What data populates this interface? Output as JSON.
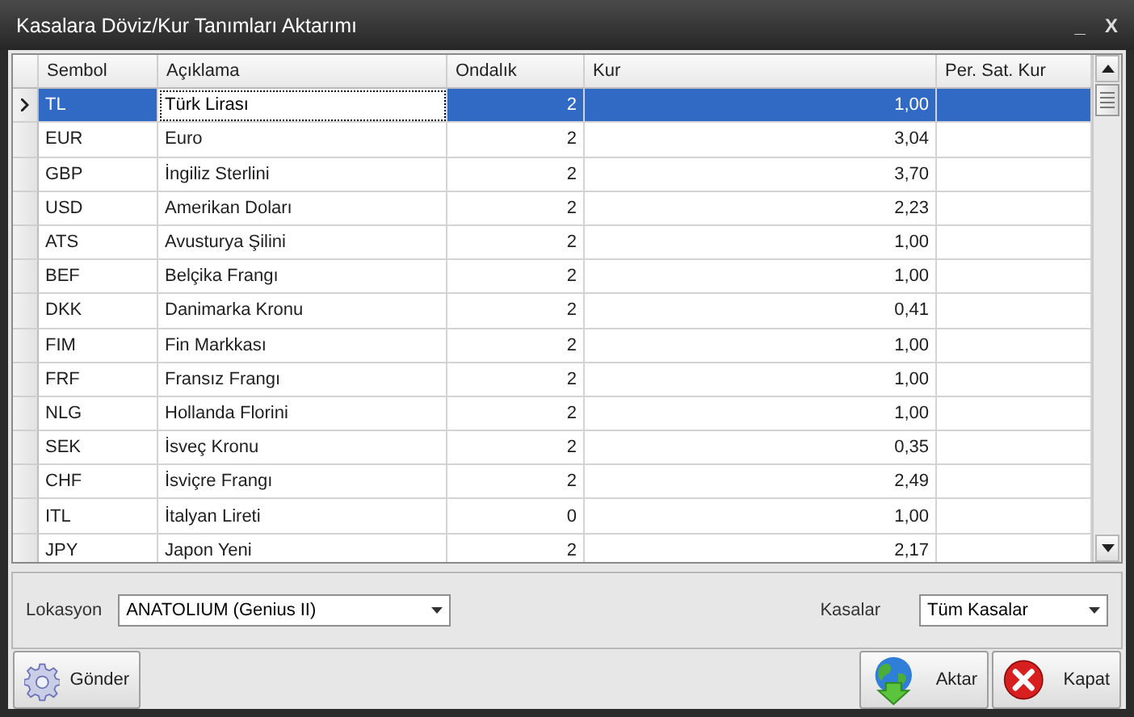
{
  "window": {
    "title": "Kasalara Döviz/Kur Tanımları Aktarımı",
    "controls": [
      "_",
      "X"
    ]
  },
  "table": {
    "columns": [
      "Sembol",
      "Açıklama",
      "Ondalık",
      "Kur",
      "Per. Sat. Kur"
    ],
    "description_cell_focused": true,
    "rows": [
      {
        "symbol": "TL",
        "description": "Türk Lirası",
        "decimals": "2",
        "rate": "1,00",
        "selected": true
      },
      {
        "symbol": "EUR",
        "description": "Euro",
        "decimals": "2",
        "rate": "3,04",
        "selected": false
      },
      {
        "symbol": "GBP",
        "description": "İngiliz Sterlini",
        "decimals": "2",
        "rate": "3,70",
        "selected": false
      },
      {
        "symbol": "USD",
        "description": "Amerikan Doları",
        "decimals": "2",
        "rate": "2,23",
        "selected": false
      },
      {
        "symbol": "ATS",
        "description": "Avusturya Şilini",
        "decimals": "2",
        "rate": "1,00",
        "selected": false
      },
      {
        "symbol": "BEF",
        "description": "Belçika Frangı",
        "decimals": "2",
        "rate": "1,00",
        "selected": false
      },
      {
        "symbol": "DKK",
        "description": "Danimarka Kronu",
        "decimals": "2",
        "rate": "0,41",
        "selected": false
      },
      {
        "symbol": "FIM",
        "description": "Fin Markkası",
        "decimals": "2",
        "rate": "1,00",
        "selected": false
      },
      {
        "symbol": "FRF",
        "description": "Fransız Frangı",
        "decimals": "2",
        "rate": "1,00",
        "selected": false
      },
      {
        "symbol": "NLG",
        "description": "Hollanda Florini",
        "decimals": "2",
        "rate": "1,00",
        "selected": false
      },
      {
        "symbol": "SEK",
        "description": "İsveç Kronu",
        "decimals": "2",
        "rate": "0,35",
        "selected": false
      },
      {
        "symbol": "CHF",
        "description": "İsviçre Frangı",
        "decimals": "2",
        "rate": "2,49",
        "selected": false
      },
      {
        "symbol": "ITL",
        "description": "İtalyan Lireti",
        "decimals": "0",
        "rate": "1,00",
        "selected": false
      },
      {
        "symbol": "JPY",
        "description": "Japon Yeni",
        "decimals": "2",
        "rate": "2,17",
        "selected": false
      }
    ]
  },
  "filters": {
    "location": {
      "label": "Lokasyon",
      "value": "ANATOLIUM (Genius II)"
    },
    "registers": {
      "label": "Kasalar",
      "value": "Tüm Kasalar"
    }
  },
  "buttons": [
    {
      "kind": "send",
      "label": "Gönder"
    },
    {
      "kind": "transfer",
      "label": "Aktar"
    },
    {
      "kind": "close",
      "label": "Kapat"
    }
  ]
}
